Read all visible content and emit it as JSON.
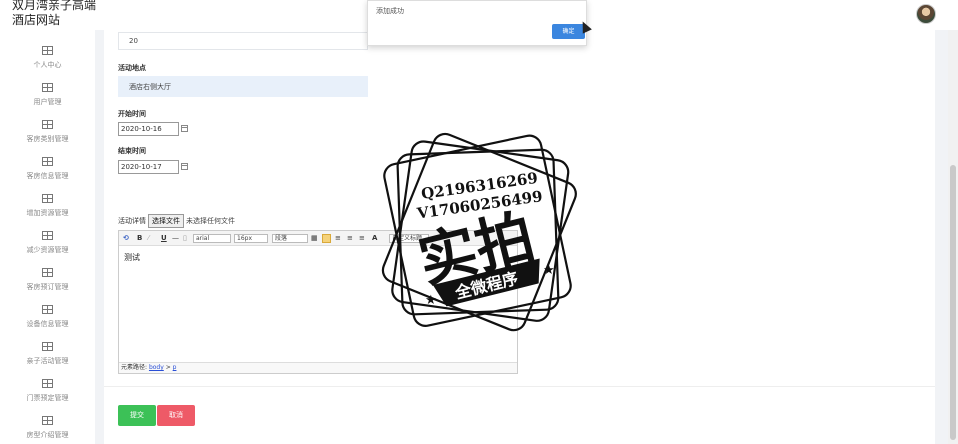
{
  "header": {
    "title": "双月湾亲子高端酒店网站"
  },
  "sidebar": {
    "items": [
      {
        "label": "个人中心"
      },
      {
        "label": "用户管理"
      },
      {
        "label": "客房类别管理"
      },
      {
        "label": "客房信息管理"
      },
      {
        "label": "增加资源管理"
      },
      {
        "label": "减少资源管理"
      },
      {
        "label": "客房预订管理"
      },
      {
        "label": "设备信息管理"
      },
      {
        "label": "亲子活动管理"
      },
      {
        "label": "门票预定管理"
      },
      {
        "label": "房型介绍管理"
      }
    ]
  },
  "form": {
    "top_value": "20",
    "location_label": "活动地点",
    "location_value": "酒店右侧大厅",
    "start_label": "开始时间",
    "start_value": "2020-10-16",
    "end_label": "结束时间",
    "end_value": "2020-10-17",
    "detail_label": "活动详情",
    "file_button": "选择文件",
    "file_status": "未选择任何文件",
    "submit": "提交",
    "cancel": "取消"
  },
  "editor": {
    "font_family": "arial",
    "font_size": "16px",
    "paragraph": "段落",
    "custom_title": "自定义标题",
    "content": "测试",
    "status_prefix": "元素路径:",
    "status_path_body": "body",
    "status_path_sep": " > ",
    "status_path_p": "p"
  },
  "dialog": {
    "message": "添加成功",
    "ok": "确定"
  },
  "watermark": {
    "line1": "Q2196316269",
    "line2": "V17060256499",
    "big": "实拍",
    "banner": "全微程序"
  },
  "colors": {
    "submit": "#3cc157",
    "cancel": "#ee5a67",
    "dialog_ok": "#3b86df"
  }
}
